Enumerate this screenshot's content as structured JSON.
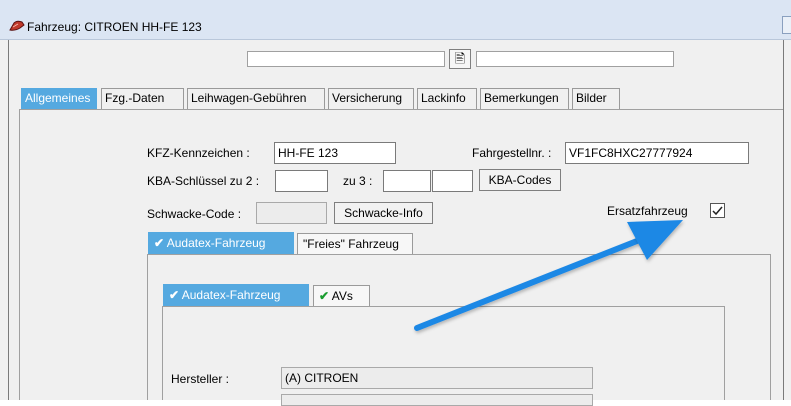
{
  "window": {
    "title": "Fahrzeug: CITROEN HH-FE 123",
    "toolbar_field_1": "",
    "toolbar_field_2": "",
    "toolbar_icon": "document-icon"
  },
  "tabs": [
    {
      "label": "Allgemeines",
      "active": true
    },
    {
      "label": "Fzg.-Daten",
      "active": false
    },
    {
      "label": "Leihwagen-Gebühren",
      "active": false
    },
    {
      "label": "Versicherung",
      "active": false
    },
    {
      "label": "Lackinfo",
      "active": false
    },
    {
      "label": "Bemerkungen",
      "active": false
    },
    {
      "label": "Bilder",
      "active": false
    }
  ],
  "form": {
    "kfz_label": "KFZ-Kennzeichen :",
    "kfz_value": "HH-FE 123",
    "fahrgestell_label": "Fahrgestellnr. :",
    "fahrgestell_value": "VF1FC8HXC27777924",
    "kba_label": "KBA-Schlüssel zu 2 :",
    "kba_value_2": "",
    "kba_zu3_label": "zu 3 :",
    "kba_value_3a": "",
    "kba_value_3b": "",
    "kba_button": "KBA-Codes",
    "schwacke_label": "Schwacke-Code :",
    "schwacke_value": "",
    "schwacke_button": "Schwacke-Info",
    "ersatz_label": "Ersatzfahrzeug",
    "ersatz_checked": true
  },
  "vehicle_tabs": [
    {
      "label": "Audatex-Fahrzeug",
      "active": true,
      "check": "✔"
    },
    {
      "label": "\"Freies\" Fahrzeug",
      "active": false
    }
  ],
  "sub_tabs": [
    {
      "label": "Audatex-Fahrzeug",
      "active": true,
      "check": "✔"
    },
    {
      "label": "AVs",
      "active": false,
      "check": "✔"
    }
  ],
  "details": {
    "hersteller_label": "Hersteller :",
    "hersteller_value": "(A)  CITROEN"
  },
  "colors": {
    "accent": "#55a9e0",
    "arrow": "#1e88e5",
    "check_green": "#1a9c2f"
  }
}
